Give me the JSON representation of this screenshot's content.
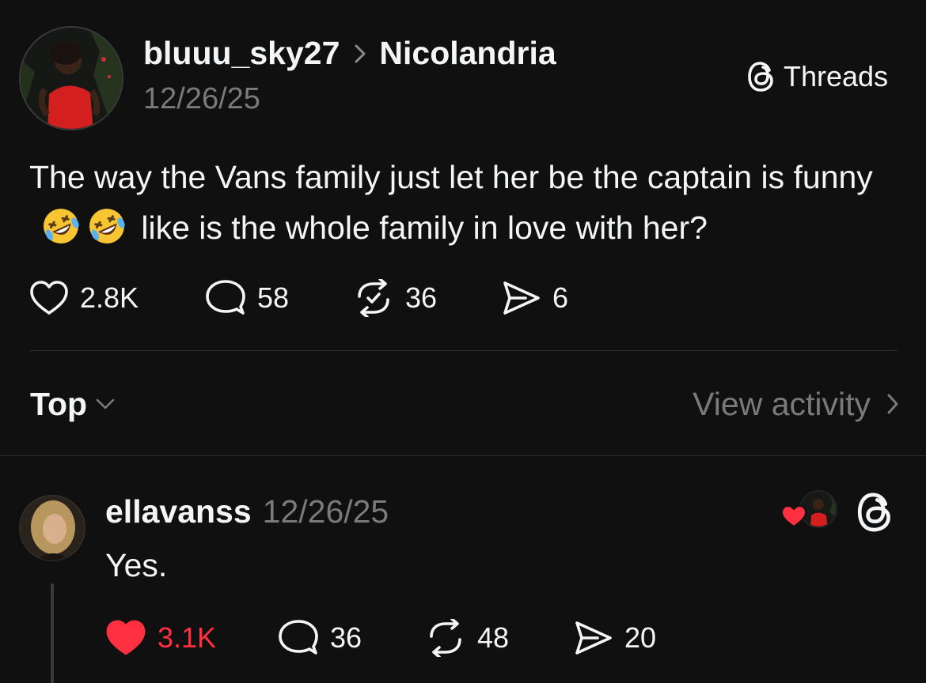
{
  "post": {
    "author": "bluuu_sky27",
    "reply_to": "Nicolandria",
    "separator": "›",
    "date": "12/26/25",
    "brand_label": "Threads",
    "text_part1": "The way the Vans family just let her be the captain is funny",
    "text_part2": " like is the whole family in love with her?",
    "emojis": [
      "rolling-on-floor-laughing",
      "rolling-on-floor-laughing"
    ],
    "stats": {
      "likes": "2.8K",
      "replies": "58",
      "reposts": "36",
      "shares": "6"
    }
  },
  "sort": {
    "label": "Top",
    "view_activity": "View activity"
  },
  "reply": {
    "author": "ellavanss",
    "date": "12/26/25",
    "text": "Yes.",
    "stats": {
      "likes": "3.1K",
      "replies": "36",
      "reposts": "48",
      "shares": "20"
    },
    "liked": true
  },
  "colors": {
    "background": "#101010",
    "text": "#f3f5f7",
    "muted": "#7a7a7a",
    "like_red": "#ff3040"
  }
}
